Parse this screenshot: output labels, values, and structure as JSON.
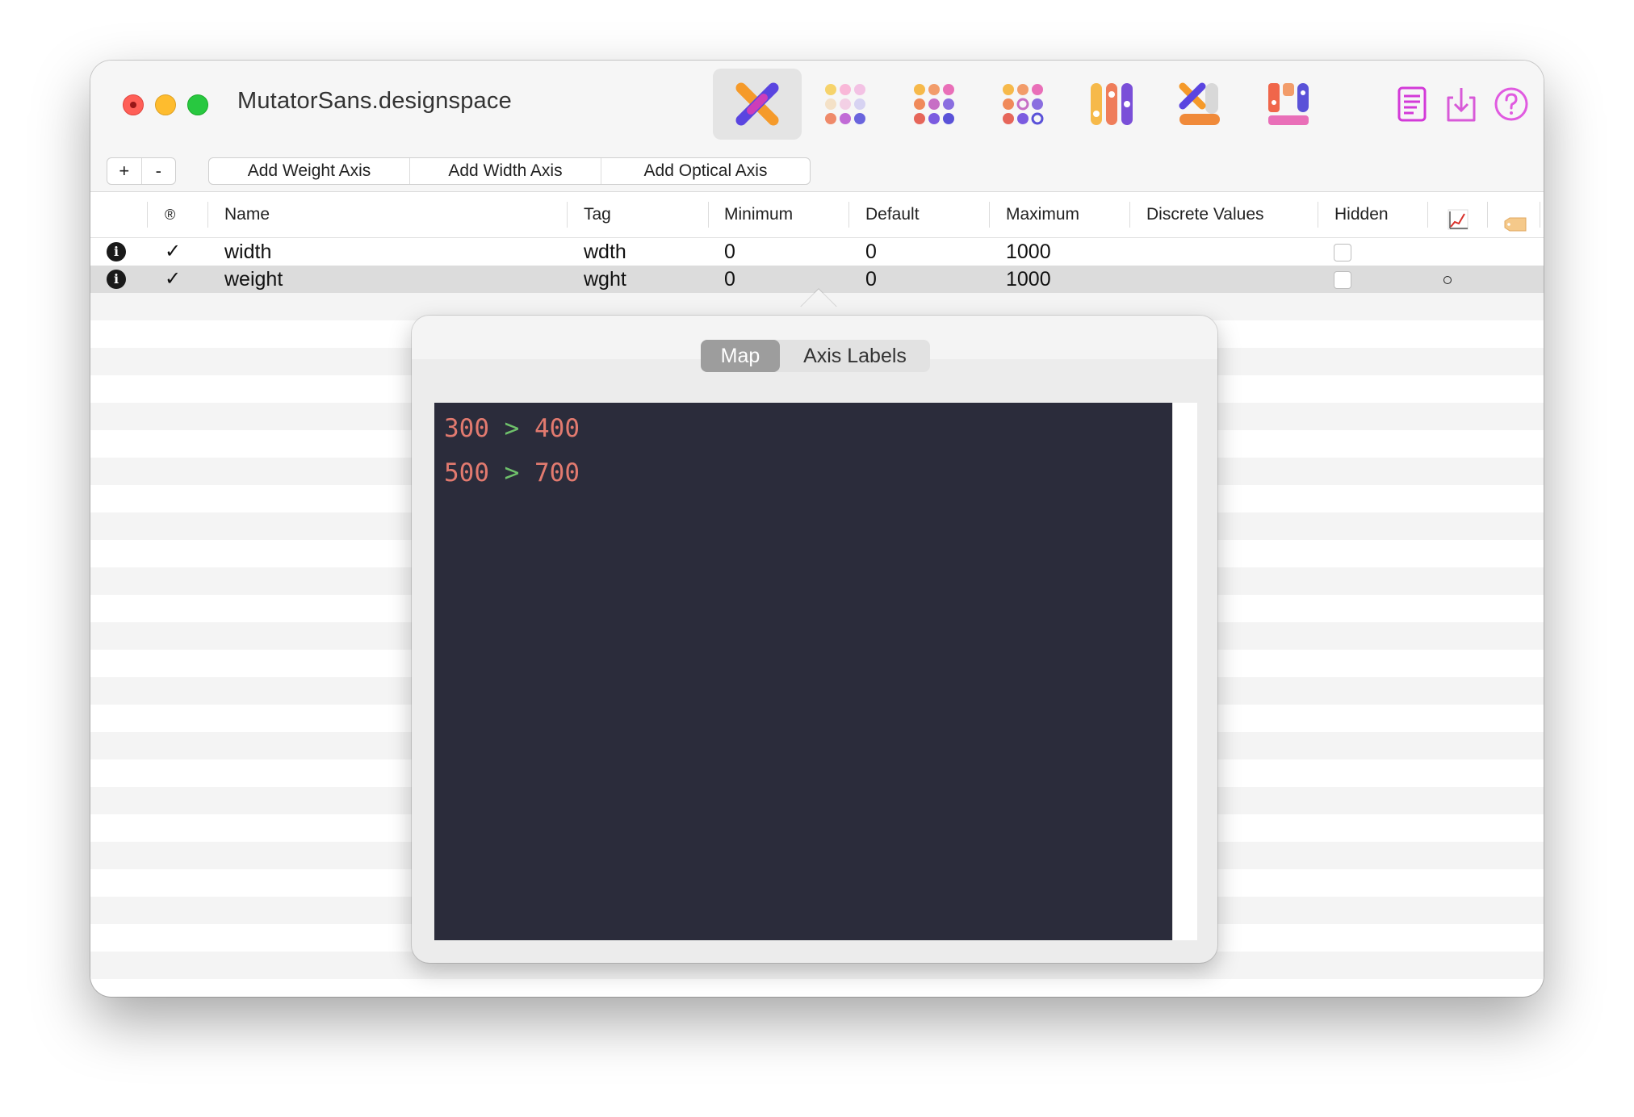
{
  "window": {
    "title": "MutatorSans.designspace",
    "traffic_lights": {
      "close": "#ff5f57",
      "minimize": "#febc2e",
      "zoom": "#28c840"
    }
  },
  "toolbar": {
    "tools": [
      {
        "icon": "axes-x-icon",
        "active": true
      },
      {
        "icon": "sources-dots-icon",
        "active": false
      },
      {
        "icon": "instances-dots-icon",
        "active": false
      },
      {
        "icon": "rules-dots-icon",
        "active": false
      },
      {
        "icon": "bars-icon",
        "active": false
      },
      {
        "icon": "stacked-x-icon",
        "active": false
      },
      {
        "icon": "grid-blocks-icon",
        "active": false
      }
    ],
    "right_tools": [
      "notes-icon",
      "export-download-icon",
      "help-icon"
    ],
    "accent": "#e040e0"
  },
  "buttons": {
    "add": "+",
    "remove": "-",
    "add_weight": "Add Weight Axis",
    "add_width": "Add Width Axis",
    "add_optical": "Add Optical Axis"
  },
  "table": {
    "columns": {
      "registered": "®",
      "name": "Name",
      "tag": "Tag",
      "minimum": "Minimum",
      "default": "Default",
      "maximum": "Maximum",
      "discrete": "Discrete Values",
      "hidden": "Hidden",
      "map_icon": "chart-line-icon",
      "label_icon": "tag-label-icon"
    },
    "rows": [
      {
        "info": "i",
        "registered": "✓",
        "name": "width",
        "tag": "wdth",
        "minimum": "0",
        "default": "0",
        "maximum": "1000",
        "hidden": false,
        "has_map": false,
        "selected": false
      },
      {
        "info": "i",
        "registered": "✓",
        "name": "weight",
        "tag": "wght",
        "minimum": "0",
        "default": "0",
        "maximum": "1000",
        "hidden": false,
        "has_map": true,
        "selected": true
      }
    ]
  },
  "popover": {
    "tabs": {
      "map": "Map",
      "labels": "Axis Labels"
    },
    "active_tab": "Map",
    "separator": ">",
    "map_lines": [
      {
        "from": "300",
        "to": "400"
      },
      {
        "from": "500",
        "to": "700"
      }
    ],
    "colors": {
      "number": "#e27a6f",
      "arrow": "#6fc16b",
      "background": "#2b2c3b"
    }
  }
}
